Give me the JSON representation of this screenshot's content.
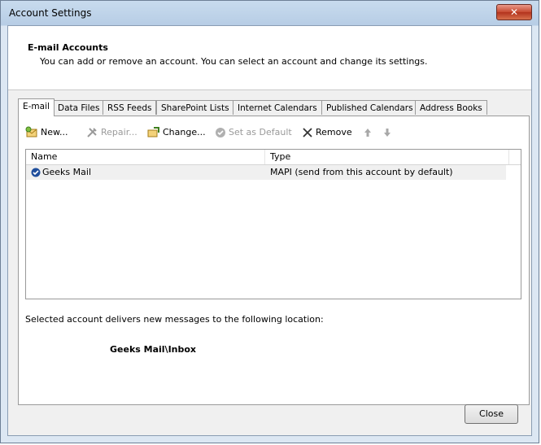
{
  "window": {
    "title": "Account Settings",
    "close_glyph": "✕"
  },
  "header": {
    "title": "E-mail Accounts",
    "subtitle": "You can add or remove an account. You can select an account and change its settings."
  },
  "tabs": [
    {
      "label": "E-mail",
      "active": true
    },
    {
      "label": "Data Files"
    },
    {
      "label": "RSS Feeds"
    },
    {
      "label": "SharePoint Lists"
    },
    {
      "label": "Internet Calendars"
    },
    {
      "label": "Published Calendars"
    },
    {
      "label": "Address Books"
    }
  ],
  "toolbar": {
    "new_label": "New...",
    "repair_label": "Repair...",
    "change_label": "Change...",
    "set_default_label": "Set as Default",
    "remove_label": "Remove"
  },
  "list": {
    "columns": {
      "name": "Name",
      "type": "Type"
    },
    "rows": [
      {
        "name": "Geeks Mail",
        "type": "MAPI (send from this account by default)"
      }
    ]
  },
  "footer": {
    "delivery_text": "Selected account delivers new messages to the following location:",
    "location": "Geeks Mail\\Inbox"
  },
  "buttons": {
    "close_label": "Close"
  },
  "colors": {
    "close_red": "#c6492f",
    "check_blue": "#1f4e9c"
  }
}
